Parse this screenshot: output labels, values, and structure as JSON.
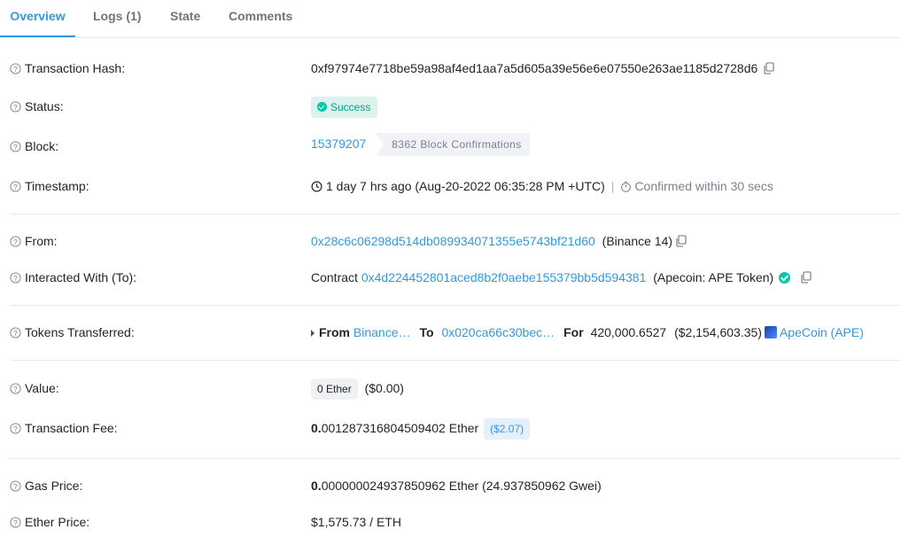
{
  "tabs": [
    {
      "label": "Overview"
    },
    {
      "label": "Logs (1)"
    },
    {
      "label": "State"
    },
    {
      "label": "Comments"
    }
  ],
  "rows": {
    "tx_hash": {
      "label": "Transaction Hash:",
      "value": "0xf97974e7718be59a98af4ed1aa7a5d605a39e56e6e07550e263ae1185d2728d6"
    },
    "status": {
      "label": "Status:",
      "value": "Success"
    },
    "block": {
      "label": "Block:",
      "number": "15379207",
      "confirmations": "8362 Block Confirmations"
    },
    "timestamp": {
      "label": "Timestamp:",
      "value": "1 day 7 hrs ago (Aug-20-2022 06:35:28 PM +UTC)",
      "separator": "|",
      "confirmed": "Confirmed within 30 secs"
    },
    "from": {
      "label": "From:",
      "address": "0x28c6c06298d514db089934071355e5743bf21d60",
      "name": "(Binance 14)"
    },
    "to": {
      "label": "Interacted With (To):",
      "prefix": "Contract",
      "address": "0x4d224452801aced8b2f0aebe155379bb5d594381",
      "name": "(Apecoin: APE Token)"
    },
    "tokens": {
      "label": "Tokens Transferred:",
      "from_label": "From",
      "from_value": "Binance…",
      "to_label": "To",
      "to_value": "0x020ca66c30bec…",
      "for_label": "For",
      "amount": "420,000.6527",
      "usd": "($2,154,603.35)",
      "token": "ApeCoin (APE)"
    },
    "value": {
      "label": "Value:",
      "amount": "0 Ether",
      "usd": "($0.00)"
    },
    "fee": {
      "label": "Transaction Fee:",
      "amount_bold": "0.",
      "amount_rest": "001287316804509402 Ether",
      "usd": "($2.07)"
    },
    "gas": {
      "label": "Gas Price:",
      "amount_bold": "0.",
      "amount_rest": "000000024937850962 Ether (24.937850962 Gwei)"
    },
    "ether_price": {
      "label": "Ether Price:",
      "value": "$1,575.73 / ETH"
    }
  },
  "colors": {
    "link": "#3498db",
    "success": "#00c9a7",
    "border": "#e7eaf3",
    "muted": "#77838f"
  }
}
